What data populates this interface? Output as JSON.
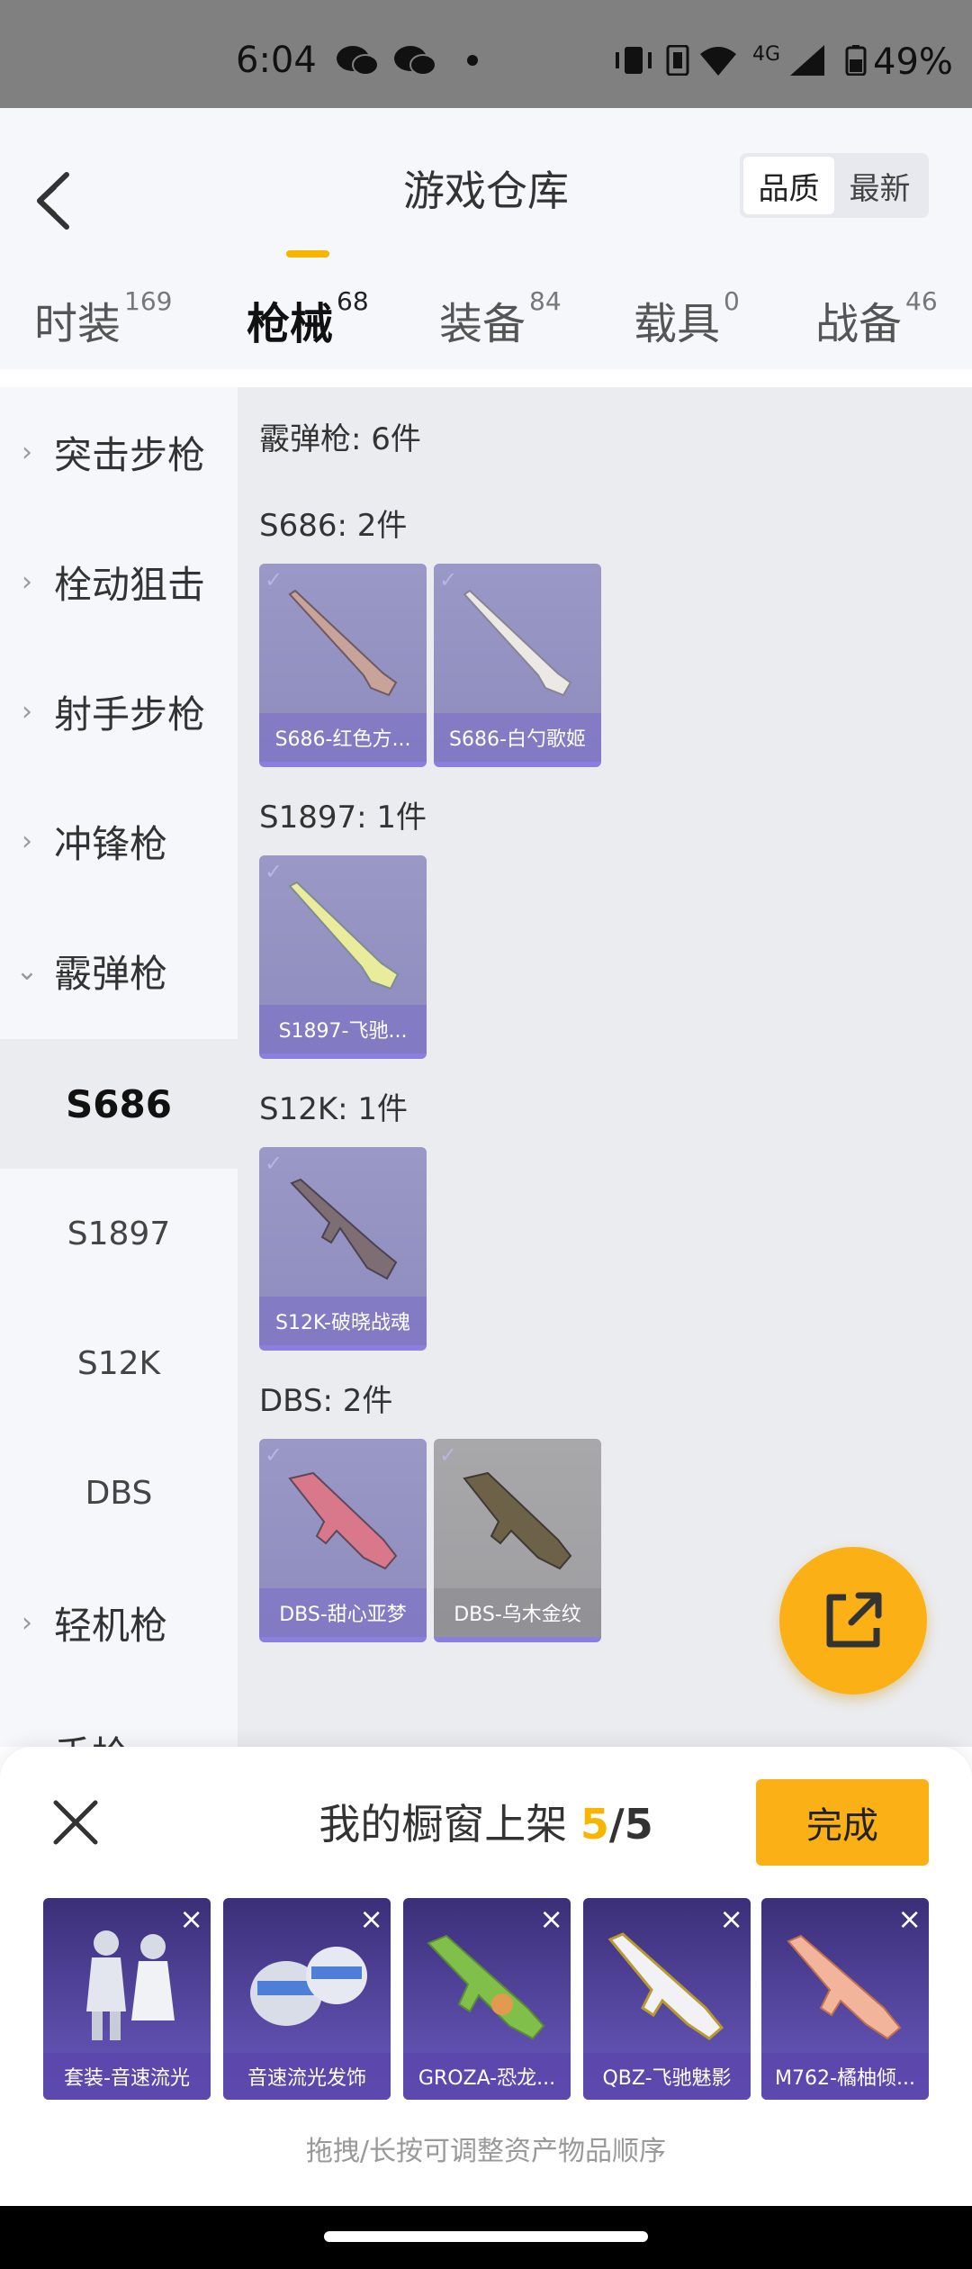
{
  "status_bar": {
    "time": "6:04",
    "battery": "49%",
    "network": "4G"
  },
  "header": {
    "title": "游戏仓库",
    "sort": [
      "品质",
      "最新"
    ]
  },
  "tabs": [
    {
      "label": "时装",
      "count": "169"
    },
    {
      "label": "枪械",
      "count": "68"
    },
    {
      "label": "装备",
      "count": "84"
    },
    {
      "label": "载具",
      "count": "0"
    },
    {
      "label": "战备",
      "count": "46"
    }
  ],
  "sidebar": {
    "categories": [
      "突击步枪",
      "栓动狙击",
      "射手步枪",
      "冲锋枪",
      "霰弹枪"
    ],
    "subcategories": [
      "S686",
      "S1897",
      "S12K",
      "DBS"
    ],
    "after": [
      "轻机枪",
      "手枪"
    ]
  },
  "content": {
    "summary": "霰弹枪: 6件",
    "groups": [
      {
        "title": "S686: 2件",
        "items": [
          "S686-红色方...",
          "S686-白勺歌姬"
        ]
      },
      {
        "title": "S1897: 1件",
        "items": [
          "S1897-飞驰..."
        ]
      },
      {
        "title": "S12K: 1件",
        "items": [
          "S12K-破晓战魂"
        ]
      },
      {
        "title": "DBS: 2件",
        "items": [
          "DBS-甜心亚梦",
          "DBS-乌木金纹"
        ]
      }
    ]
  },
  "showcase": {
    "title_prefix": "我的橱窗上架 ",
    "current": "5",
    "total": "/5",
    "done": "完成",
    "items": [
      "套装-音速流光",
      "音速流光发饰",
      "GROZA-恐龙...",
      "QBZ-飞驰魅影",
      "M762-橘柚倾..."
    ],
    "hint": "拖拽/长按可调整资产物品顺序"
  },
  "colors": {
    "accent": "#fbb116",
    "item_purple": "#9a98c6"
  }
}
